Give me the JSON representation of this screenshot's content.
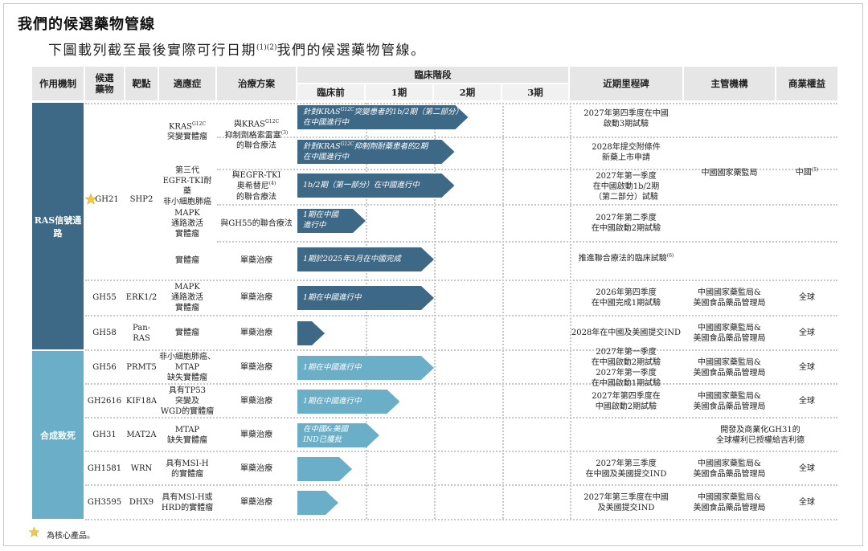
{
  "page": {
    "title": "我們的候選藥物管線",
    "subtitle_pre": "下圖載列截至最後實際可行日期",
    "subtitle_sup": "(1)(2)",
    "subtitle_post": "我們的候選藥物管線。"
  },
  "headers": {
    "mechanism": "作用機制",
    "candidate": "候選\n藥物",
    "target": "靶點",
    "indication": "適應症",
    "regimen": "治療方案",
    "clinical_stage": "臨床階段",
    "preclinical": "臨床前",
    "phase1": "1期",
    "phase2": "2期",
    "phase3": "3期",
    "milestone": "近期里程碑",
    "regulator": "主管機構",
    "rights": "商業權益"
  },
  "mechanisms": [
    {
      "label": "RAS信號通路",
      "color": "#3d6886"
    },
    {
      "label": "合成致死",
      "color": "#6aafc7"
    }
  ],
  "gh21": {
    "candidate": "GH21",
    "target": "SHP2",
    "regulator": "中國國家藥監局",
    "rights": "中國",
    "rights_sup": "(5)",
    "sub": [
      {
        "indication": "KRAS",
        "ind_sup": "G12C",
        "indication2": "突變實體瘤",
        "regimen": "與KRAS",
        "reg_sup": "G12C",
        "regimen2": "抑制劑格索雷塞",
        "reg_sup2": "(3)",
        "regimen3": "的聯合療法",
        "arrows": [
          {
            "line1": "針對KRAS",
            "sup": "G12C",
            "line1b": "突變患者的1b/2期（第二部分）",
            "line2": "在中國進行中",
            "stage": 2.5
          },
          {
            "line1": "針對KRAS",
            "sup": "G12C",
            "line1b": "抑制劑耐藥患者的2期",
            "line2": "在中國進行中",
            "stage": 2.3
          }
        ],
        "milestones": [
          "2027年第四季度在中國\n啟動3期試驗",
          "2028年提交附條件\n新藥上市申請"
        ]
      },
      {
        "indication": "第三代\nEGFR-TKI耐藥\n非小細胞肺癌",
        "regimen": "與EGFR-TKI\n奧希替尼",
        "reg_sup": "(4)",
        "regimen2": "的聯合療法",
        "arrows": [
          {
            "line1": "1b/2期（第一部分）在中國進行中",
            "stage": 2.3
          }
        ],
        "milestones": [
          "2027年第一季度\n在中國啟動1b/2期\n（第二部分）試驗"
        ]
      },
      {
        "indication": "MAPK\n通路激活\n實體瘤",
        "regimen": "與GH55的聯合療法",
        "arrows": [
          {
            "line1": "1期在中國",
            "line2": "進行中",
            "stage": 1.0
          }
        ],
        "milestones": [
          "2027年第二季度\n在中國啟動2期試驗"
        ]
      },
      {
        "indication": "實體瘤",
        "regimen": "單藥治療",
        "arrows": [
          {
            "line1": "1期於2025年3月在中國完成",
            "stage": 2.0
          }
        ],
        "milestones": [
          "推進聯合療法的臨床試驗"
        ],
        "milestone_sup": "(6)"
      }
    ]
  },
  "rows": [
    {
      "candidate": "GH55",
      "target": "ERK1/2",
      "indication": "MAPK\n通路激活\n實體瘤",
      "regimen": "單藥治療",
      "arrow": {
        "line1": "1期在中國進行中",
        "stage": 2.0,
        "mech": 0
      },
      "milestone": "2026年第四季度\n在中國完成1期試驗",
      "regulator": "中國國家藥監局&\n美國食品藥品管理局",
      "rights": "全球"
    },
    {
      "candidate": "GH58",
      "target": "Pan-RAS",
      "indication": "實體瘤",
      "regimen": "單藥治療",
      "arrow": {
        "line1": "",
        "stage": 0.4,
        "mech": 0
      },
      "milestone": "2028年在中國及美國提交IND",
      "regulator": "中國國家藥監局&\n美國食品藥品管理局",
      "rights": "全球"
    },
    {
      "candidate": "GH56",
      "target": "PRMT5",
      "indication": "非小細胞肺癌、\nMTAP\n缺失實體瘤",
      "regimen": "單藥治療",
      "arrow": {
        "line1": "1期在中國進行中",
        "stage": 2.0,
        "mech": 1
      },
      "milestone": "2027年第一季度\n在中國啟動2期試驗\n2027年第一季度\n在中國啟動1期試驗",
      "regulator": "中國國家藥監局&\n美國食品藥品管理局",
      "rights": "全球"
    },
    {
      "candidate": "GH2616",
      "target": "KIF18A",
      "indication": "具有TP53\n突變及\nWGD的實體瘤",
      "regimen": "單藥治療",
      "arrow": {
        "line1": "1期在中國進行中",
        "stage": 1.5,
        "mech": 1
      },
      "milestone": "2027年第四季度在\n中國啟動2期試驗",
      "regulator": "中國國家藥監局&\n美國食品藥品管理局",
      "rights": "全球"
    },
    {
      "candidate": "GH31",
      "target": "MAT2A",
      "indication": "MTAP\n缺失實體瘤",
      "regimen": "單藥治療",
      "arrow": {
        "line1": "在中國&美國",
        "line2": "IND已獲批",
        "stage": 1.2,
        "mech": 1
      },
      "milestone": "",
      "regulator": "開發及商業化GH31的\n全球權利已授權給吉利德",
      "rights": "",
      "span": true
    },
    {
      "candidate": "GH1581",
      "target": "WRN",
      "indication": "具有MSI-H\n的實體瘤",
      "regimen": "單藥治療",
      "arrow": {
        "line1": "",
        "stage": 0.8,
        "mech": 1
      },
      "milestone": "2027年第三季度\n在中國及美國提交IND",
      "regulator": "中國國家藥監局&\n美國食品藥品管理局",
      "rights": "全球"
    },
    {
      "candidate": "GH3595",
      "target": "DHX9",
      "indication": "具有MSI-H或\nHRD的實體瘤",
      "regimen": "單藥治療",
      "arrow": {
        "line1": "",
        "stage": 0.6,
        "mech": 1
      },
      "milestone": "2027年第三季度在中國\n及美國提交IND",
      "regulator": "中國國家藥監局&\n美國食品藥品管理局",
      "rights": "全球"
    }
  ],
  "footnote": "為核心產品。",
  "colors": {
    "dark": "#3d6886",
    "light": "#6aafc7",
    "star": "#f2c94c"
  },
  "icons": {
    "core_product": "star-icon"
  }
}
